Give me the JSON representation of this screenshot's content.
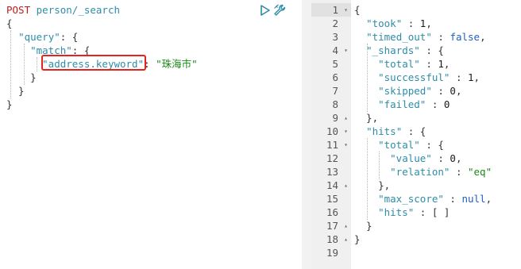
{
  "request": {
    "method": "POST",
    "path": "person/_search",
    "field": "\"address.keyword\"",
    "value": "\"珠海市\""
  },
  "response": {
    "took": "1",
    "timed_out": "false",
    "total": "1",
    "successful": "1",
    "skipped": "0",
    "failed": "0",
    "hits_total_value": "0",
    "hits_relation": "\"eq\"",
    "max_score": "null"
  },
  "line_numbers": [
    "1",
    "2",
    "3",
    "4",
    "5",
    "6",
    "7",
    "8",
    "9",
    "10",
    "11",
    "12",
    "13",
    "14",
    "15",
    "16",
    "17",
    "18",
    "19"
  ],
  "icons": {
    "play": "play-icon",
    "wrench": "wrench-icon"
  },
  "colors": {
    "highlight": "#e8221b",
    "method": "#c01b1b",
    "key": "#2e8ca8",
    "string": "#1a8a1a"
  }
}
